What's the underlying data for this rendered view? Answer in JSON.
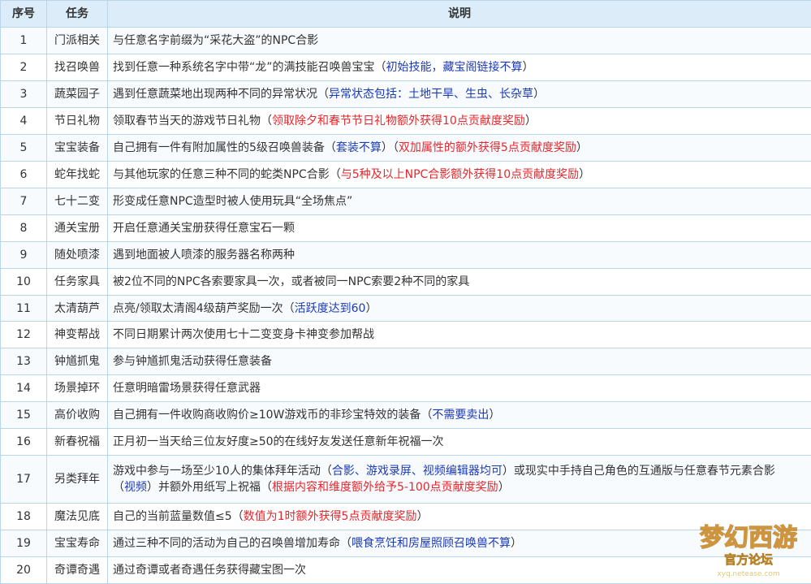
{
  "headers": [
    "序号",
    "任务",
    "说明"
  ],
  "colors": {
    "header_bg": "#dcedf9",
    "border": "#b9d6ea",
    "note_blue": "#1c3ab5",
    "note_red": "#e8262b"
  },
  "rows": [
    {
      "no": "1",
      "task": "门派相关",
      "desc": "与任意名字前缀为“采花大盗”的NPC合影",
      "open": "",
      "blue": "",
      "mid": "",
      "red": "",
      "close": ""
    },
    {
      "no": "2",
      "task": "找召唤兽",
      "desc": "找到任意一种系统名字中带“龙”的满技能召唤兽宝宝",
      "open": "（",
      "blue": "初始技能，藏宝阁链接不算",
      "mid": "",
      "red": "",
      "close": "）"
    },
    {
      "no": "3",
      "task": "蔬菜园子",
      "desc": "遇到任意蔬菜地出现两种不同的异常状况",
      "open": "（",
      "blue": "异常状态包括：土地干旱、生虫、长杂草",
      "mid": "",
      "red": "",
      "close": "）"
    },
    {
      "no": "4",
      "task": "节日礼物",
      "desc": "领取春节当天的游戏节日礼物",
      "open": "（",
      "blue": "",
      "mid": "",
      "red": "领取除夕和春节节日礼物额外获得10点贡献度奖励",
      "close": "）"
    },
    {
      "no": "5",
      "task": "宝宝装备",
      "desc": "自己拥有一件有附加属性的5级召唤兽装备",
      "open": "（",
      "blue": "套装不算",
      "mid": "）（",
      "red": "双加属性的额外获得5点贡献度奖励",
      "close": "）"
    },
    {
      "no": "6",
      "task": "蛇年找蛇",
      "desc": "与其他玩家的任意三种不同的蛇类NPC合影",
      "open": "（",
      "blue": "",
      "mid": "",
      "red": "与5种及以上NPC合影额外获得10点贡献度奖励",
      "close": "）"
    },
    {
      "no": "7",
      "task": "七十二变",
      "desc": "形变成任意NPC造型时被人使用玩具“全场焦点”",
      "open": "",
      "blue": "",
      "mid": "",
      "red": "",
      "close": ""
    },
    {
      "no": "8",
      "task": "通关宝册",
      "desc": "开启任意通关宝册获得任意宝石一颗",
      "open": "",
      "blue": "",
      "mid": "",
      "red": "",
      "close": ""
    },
    {
      "no": "9",
      "task": "随处喷漆",
      "desc": "遇到地面被人喷漆的服务器名称两种",
      "open": "",
      "blue": "",
      "mid": "",
      "red": "",
      "close": ""
    },
    {
      "no": "10",
      "task": "任务家具",
      "desc": "被2位不同的NPC各索要家具一次，或者被同一NPC索要2种不同的家具",
      "open": "",
      "blue": "",
      "mid": "",
      "red": "",
      "close": ""
    },
    {
      "no": "11",
      "task": "太清葫芦",
      "desc": "点亮/领取太清阁4级葫芦奖励一次",
      "open": "（",
      "blue": "活跃度达到60",
      "mid": "",
      "red": "",
      "close": "）"
    },
    {
      "no": "12",
      "task": "神变帮战",
      "desc": "不同日期累计两次使用七十二变变身卡神变参加帮战",
      "open": "",
      "blue": "",
      "mid": "",
      "red": "",
      "close": ""
    },
    {
      "no": "13",
      "task": "钟馗抓鬼",
      "desc": "参与钟馗抓鬼活动获得任意装备",
      "open": "",
      "blue": "",
      "mid": "",
      "red": "",
      "close": ""
    },
    {
      "no": "14",
      "task": "场景掉环",
      "desc": "任意明暗雷场景获得任意武器",
      "open": "",
      "blue": "",
      "mid": "",
      "red": "",
      "close": ""
    },
    {
      "no": "15",
      "task": "高价收购",
      "desc": "自己拥有一件收购商收购价≥10W游戏币的非珍宝特效的装备",
      "open": "（",
      "blue": "不需要卖出",
      "mid": "",
      "red": "",
      "close": "）"
    },
    {
      "no": "16",
      "task": "新春祝福",
      "desc": "正月初一当天给三位友好度≥50的在线好友发送任意新年祝福一次",
      "open": "",
      "blue": "",
      "mid": "",
      "red": "",
      "close": ""
    },
    {
      "no": "18",
      "task": "魔法见底",
      "desc": "自己的当前蓝量数值≤5",
      "open": "（",
      "blue": "",
      "mid": "",
      "red": "数值为1时额外获得5点贡献度奖励",
      "close": "）"
    },
    {
      "no": "19",
      "task": "宝宝寿命",
      "desc": "通过三种不同的活动为自己的召唤兽增加寿命",
      "open": "（",
      "blue": "喂食烹饪和房屋照顾召唤兽不算",
      "mid": "",
      "red": "",
      "close": "）"
    },
    {
      "no": "20",
      "task": "奇谭奇遇",
      "desc": "通过奇谭或者奇遇任务获得藏宝图一次",
      "open": "",
      "blue": "",
      "mid": "",
      "red": "",
      "close": ""
    }
  ],
  "row17": {
    "no": "17",
    "task": "另类拜年",
    "desc1": "游戏中参与一场至少10人的集体拜年活动（",
    "blue1": "合影、游戏录屏、视频编辑器均可",
    "desc2": "）或现实中手持自己角色的互通版与任意春节元素合影（",
    "blue2": "视频",
    "desc3": "）并额外用纸写上祝福（",
    "red": "根据内容和维度额外给予5-100点贡献度奖励",
    "close": "）"
  },
  "watermark": {
    "logo": "梦幻西游",
    "sub": "官方论坛",
    "url": "xyq.netease.com"
  }
}
